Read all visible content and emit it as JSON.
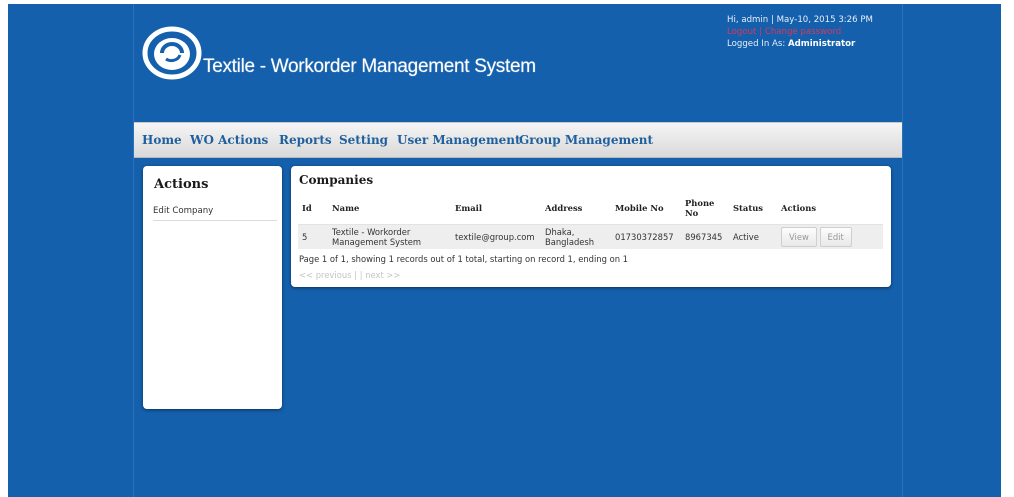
{
  "header": {
    "site_title": "Textile - Workorder Management System",
    "greeting": "Hi, admin | May-10, 2015 3:26 PM",
    "logout_label": "Logout",
    "change_password_label": "Change password",
    "link_separator": "|",
    "logged_in_prefix": "Logged In As:",
    "role": "Administrator"
  },
  "nav": {
    "items": [
      "Home",
      "WO Actions",
      "Reports",
      "Setting",
      "User Management",
      "Group Management"
    ]
  },
  "sidebar": {
    "title": "Actions",
    "links": [
      "Edit Company"
    ]
  },
  "main": {
    "title": "Companies",
    "columns": [
      "Id",
      "Name",
      "Email",
      "Address",
      "Mobile No",
      "Phone No",
      "Status",
      "Actions"
    ],
    "rows": [
      {
        "id": "5",
        "name": "Textile - Workorder Management System",
        "email": "textile@group.com",
        "address": "Dhaka, Bangladesh",
        "mobile": "01730372857",
        "phone": "8967345",
        "status": "Active",
        "view_label": "View",
        "edit_label": "Edit"
      }
    ],
    "pagination_info": "Page 1 of 1, showing 1 records out of 1 total, starting on record 1, ending on 1",
    "prev_label": "<< previous",
    "pager_sep": "|",
    "next_label": "next >>"
  },
  "colors": {
    "background": "#1560ad",
    "nav_text": "#1f5f9c",
    "link_red": "#d9385a"
  }
}
